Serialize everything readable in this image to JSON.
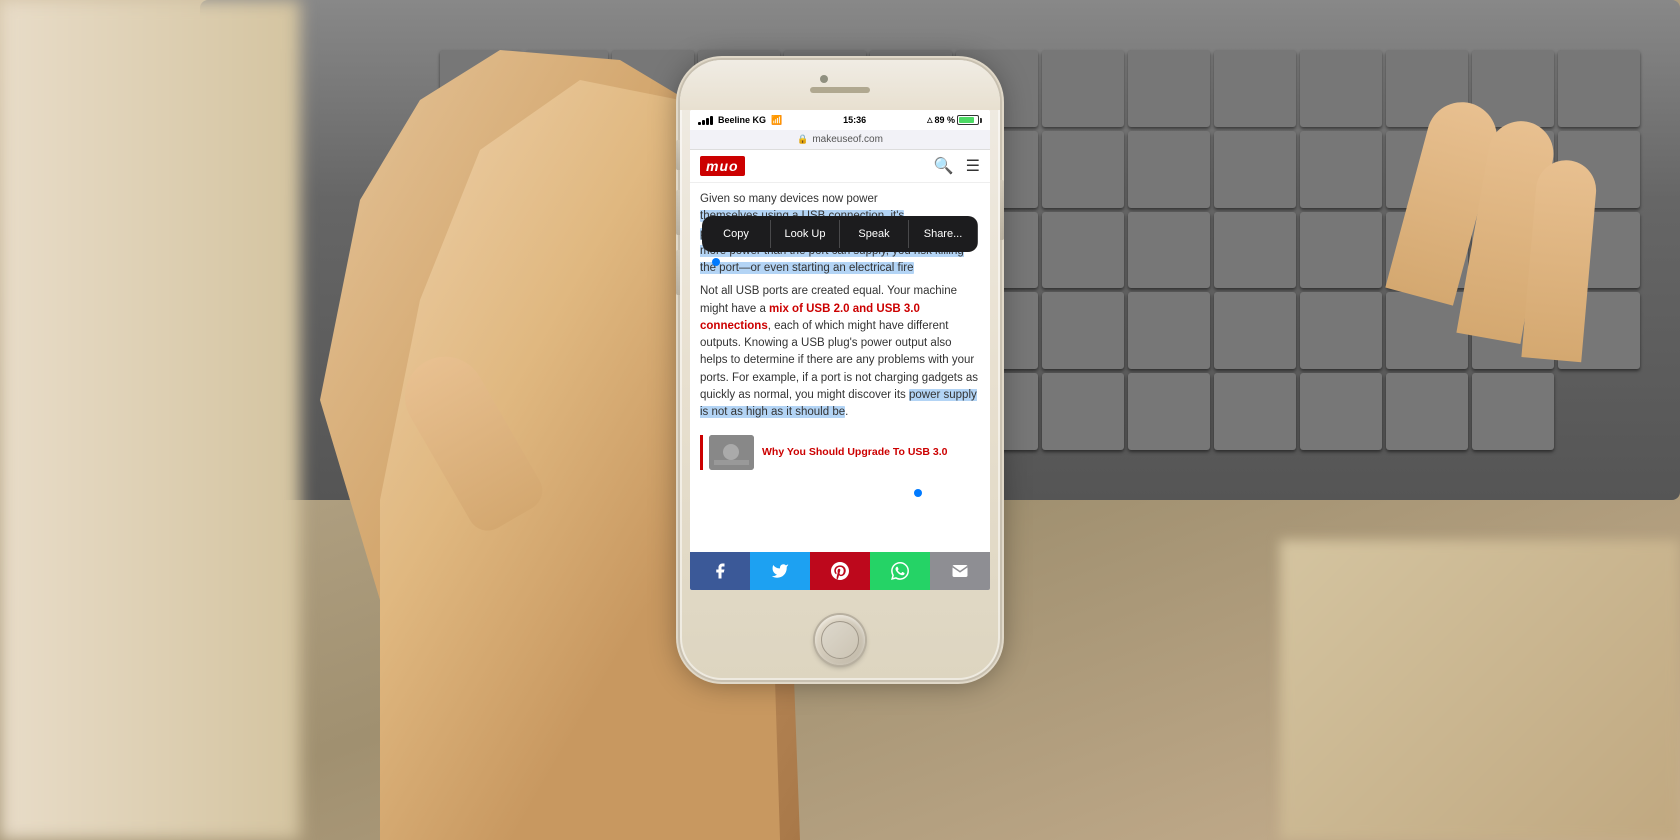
{
  "scene": {
    "background_description": "Hand holding iPhone with laptop keyboard in background"
  },
  "phone": {
    "status_bar": {
      "carrier": "Beeline KG",
      "wifi": "WiFi",
      "time": "15:36",
      "icons": "⊕ ↑ ⊗",
      "battery_percent": "89 %",
      "signal_bars": [
        3,
        5,
        7,
        9,
        11
      ]
    },
    "url_bar": {
      "url": "makeuseof.com",
      "secure": true
    },
    "nav": {
      "logo": "muo",
      "search_label": "search",
      "menu_label": "menu"
    },
    "article": {
      "text_before_highlight": "Given so many devices now power",
      "text_highlighted_1": "themselves using a USB connection, it's",
      "text_highlighted_2": "port on your laptop can supply. If a device tries to draw more power than the port can supply, you risk killing the port—or even starting an electrical fire",
      "text_normal_1": "Not all USB ports are created equal. Your machine might have a ",
      "link_text": "mix of USB 2.0 and USB 3.0 connections",
      "text_normal_2": ", each of which might have different outputs. Knowing a USB plug's power output also helps to determine if there are any problems with your ports. For example, if a port is not charging gadgets as quickly as normal, you might discover its ",
      "text_highlighted_3": "power supply is not as high as it should be",
      "text_end": "."
    },
    "copy_menu": {
      "items": [
        "Copy",
        "Look Up",
        "Speak",
        "Share..."
      ]
    },
    "related_article": {
      "title": "Why You Should Upgrade To USB 3.0"
    },
    "share_bar": {
      "buttons": [
        {
          "platform": "Facebook",
          "icon": "f",
          "color": "#3b5998"
        },
        {
          "platform": "Twitter",
          "icon": "t",
          "color": "#1da1f2"
        },
        {
          "platform": "Pinterest",
          "icon": "p",
          "color": "#bd081c"
        },
        {
          "platform": "WhatsApp",
          "icon": "w",
          "color": "#25d366"
        },
        {
          "platform": "Email",
          "icon": "✉",
          "color": "#8e8e93"
        }
      ]
    }
  }
}
